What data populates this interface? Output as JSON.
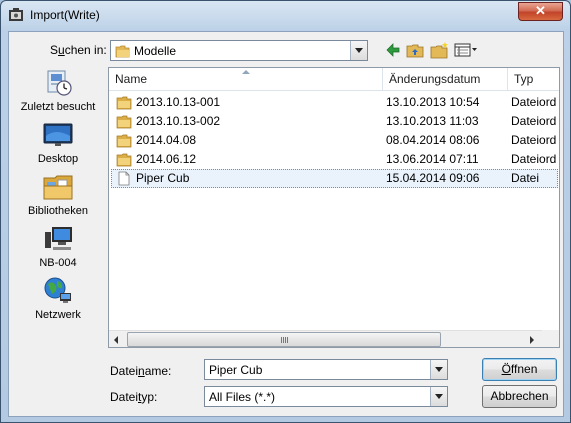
{
  "window": {
    "title": "Import(Write)",
    "close_label": "✕"
  },
  "lookin": {
    "label_pre": "S",
    "label_u": "u",
    "label_post": "chen in:",
    "value": "Modelle"
  },
  "toolbar": {
    "back": "back-icon",
    "up": "up-folder-icon",
    "new_folder": "new-folder-icon",
    "views": "views-menu-icon"
  },
  "places": [
    {
      "label": "Zuletzt besucht",
      "icon": "recent-places-icon"
    },
    {
      "label": "Desktop",
      "icon": "desktop-icon"
    },
    {
      "label": "Bibliotheken",
      "icon": "libraries-icon"
    },
    {
      "label": "NB-004",
      "icon": "computer-icon"
    },
    {
      "label": "Netzwerk",
      "icon": "network-icon"
    }
  ],
  "columns": {
    "name": "Name",
    "date": "Änderungsdatum",
    "type": "Typ"
  },
  "files": [
    {
      "name": "2013.10.13-001",
      "date": "13.10.2013 10:54",
      "type": "Dateiordn",
      "kind": "folder"
    },
    {
      "name": "2013.10.13-002",
      "date": "13.10.2013 11:03",
      "type": "Dateiordn",
      "kind": "folder"
    },
    {
      "name": "2014.04.08",
      "date": "08.04.2014 08:06",
      "type": "Dateiordn",
      "kind": "folder"
    },
    {
      "name": "2014.06.12",
      "date": "13.06.2014 07:11",
      "type": "Dateiordn",
      "kind": "folder"
    },
    {
      "name": "Piper Cub",
      "date": "15.04.2014 09:06",
      "type": "Datei",
      "kind": "file",
      "selected": true
    }
  ],
  "filename": {
    "label_pre": "Datei",
    "label_u": "n",
    "label_post": "ame:",
    "value": "Piper Cub"
  },
  "filetype": {
    "label_pre": "Datei",
    "label_u": "t",
    "label_post": "yp:",
    "value": "All Files (*.*)"
  },
  "buttons": {
    "open_u": "Ö",
    "open_rest": "ffnen",
    "cancel": "Abbrechen"
  }
}
